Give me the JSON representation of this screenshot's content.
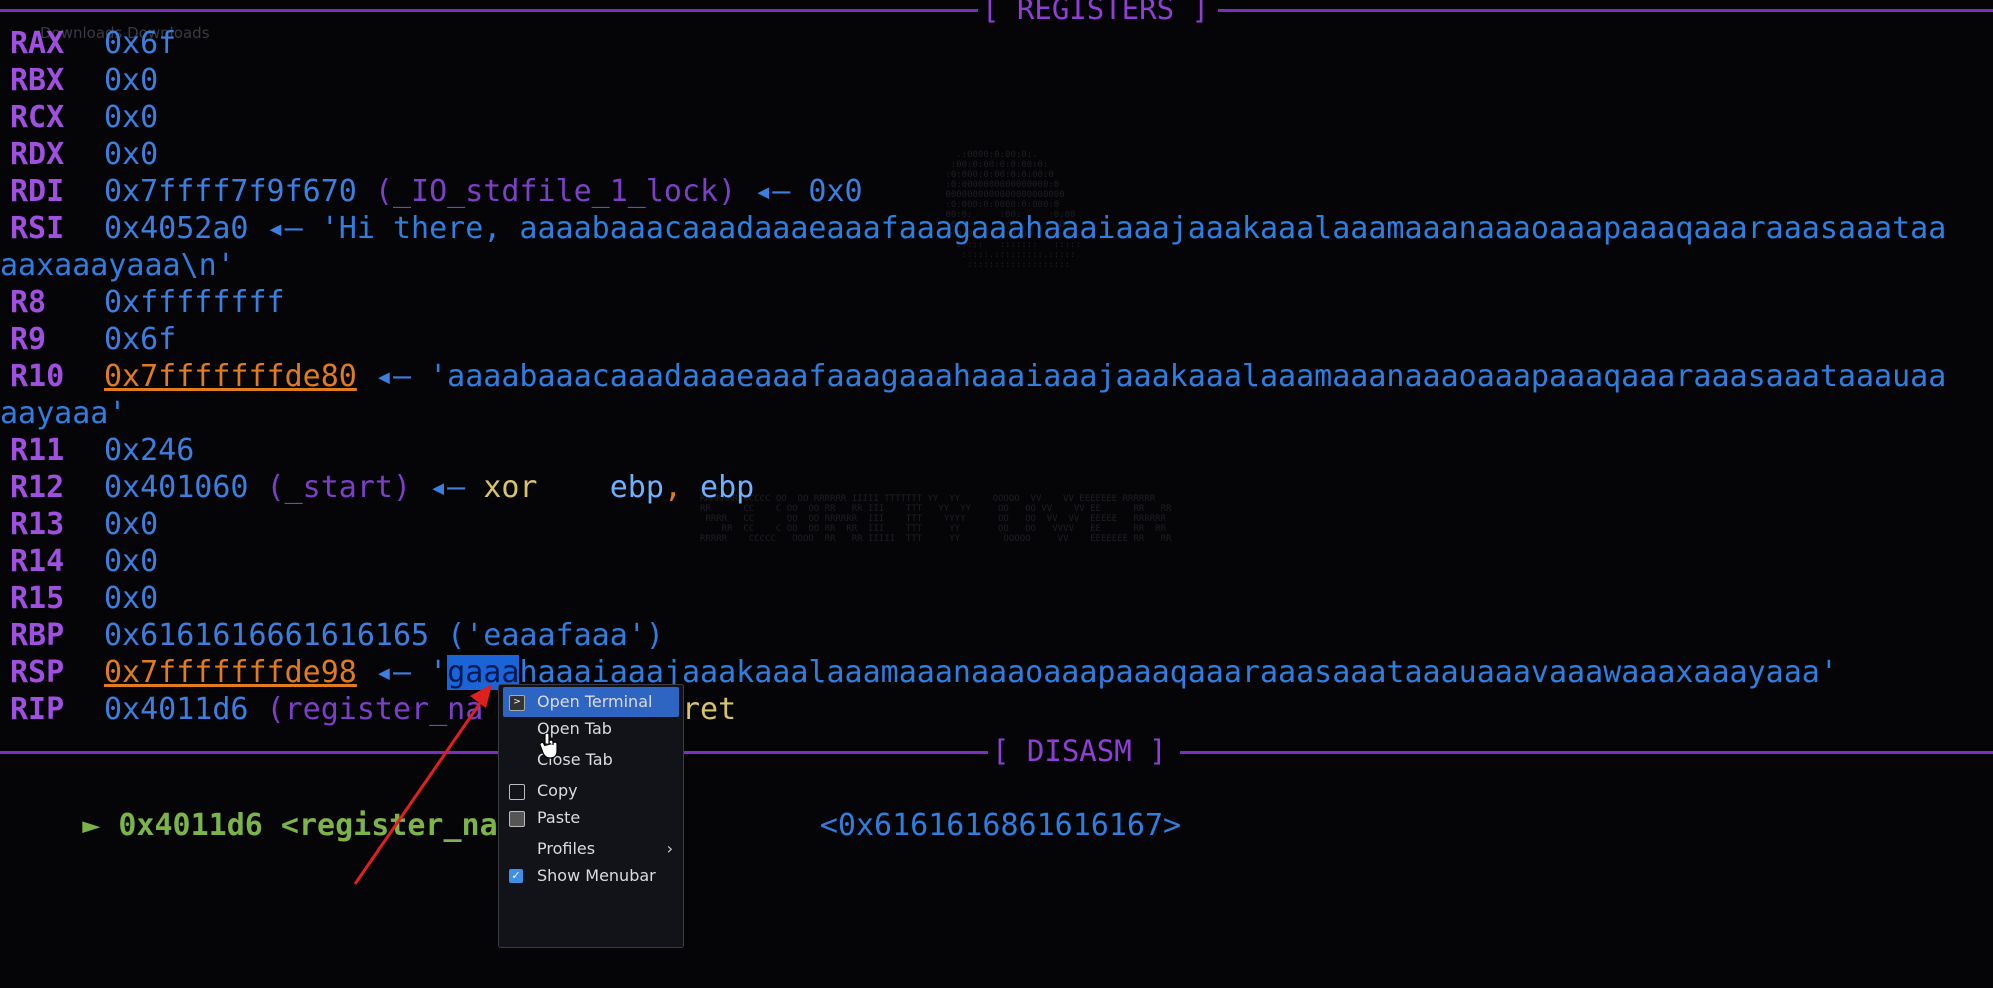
{
  "window": {
    "tab_hint": "Downloads  Downloads"
  },
  "sections": {
    "registers_title": "[ REGISTERS ]",
    "disasm_title": "[ DISASM ]"
  },
  "registers": [
    {
      "name": "RAX",
      "parts": [
        {
          "t": "0x6f",
          "c": "val"
        }
      ]
    },
    {
      "name": "RBX",
      "parts": [
        {
          "t": "0x0",
          "c": "val"
        }
      ]
    },
    {
      "name": "RCX",
      "parts": [
        {
          "t": "0x0",
          "c": "val"
        }
      ]
    },
    {
      "name": "RDX",
      "parts": [
        {
          "t": "0x0",
          "c": "val"
        }
      ]
    },
    {
      "name": "RDI",
      "parts": [
        {
          "t": "0x7ffff7f9f670",
          "c": "val"
        },
        {
          "t": " (_IO_stdfile_1_lock)",
          "c": "sym"
        },
        {
          "t": " ◂— ",
          "c": "arrow"
        },
        {
          "t": "0x0",
          "c": "val"
        }
      ]
    },
    {
      "name": "RSI",
      "parts": [
        {
          "t": "0x4052a0",
          "c": "val"
        },
        {
          "t": " ◂— ",
          "c": "arrow"
        },
        {
          "t": "'Hi there, aaaabaaacaaadaaaeaaafaaagaaahaaaiaaajaaakaaalaaamaaanaaaoaaapaaaqaaaraaasaaataa",
          "c": "str"
        }
      ]
    },
    {
      "name": "",
      "parts": [
        {
          "t": "aaxaaayaaa\\n'",
          "c": "str"
        }
      ],
      "indent": -10
    },
    {
      "name": "R8",
      "parts": [
        {
          "t": "0xffffffff",
          "c": "val"
        }
      ]
    },
    {
      "name": "R9",
      "parts": [
        {
          "t": "0x6f",
          "c": "val"
        }
      ]
    },
    {
      "name": "R10",
      "parts": [
        {
          "t": "0x7fffffffde80",
          "c": "valo"
        },
        {
          "t": " ◂— ",
          "c": "arrow"
        },
        {
          "t": "'aaaabaaacaaadaaaeaaafaaagaaahaaaiaaajaaakaaalaaamaaanaaaoaaapaaaqaaaraaasaaataaauaa",
          "c": "str"
        }
      ]
    },
    {
      "name": "",
      "parts": [
        {
          "t": "aayaaa'",
          "c": "str"
        }
      ],
      "indent": -10
    },
    {
      "name": "R11",
      "parts": [
        {
          "t": "0x246",
          "c": "val"
        }
      ]
    },
    {
      "name": "R12",
      "parts": [
        {
          "t": "0x401060",
          "c": "val"
        },
        {
          "t": " (_start)",
          "c": "sym"
        },
        {
          "t": " ◂— ",
          "c": "arrow"
        },
        {
          "t": "xor",
          "c": "op"
        },
        {
          "t": "    ebp",
          "c": "regname"
        },
        {
          "t": ",",
          "c": "comma"
        },
        {
          "t": " ebp",
          "c": "regname"
        }
      ]
    },
    {
      "name": "R13",
      "parts": [
        {
          "t": "0x0",
          "c": "val"
        }
      ]
    },
    {
      "name": "R14",
      "parts": [
        {
          "t": "0x0",
          "c": "val"
        }
      ]
    },
    {
      "name": "R15",
      "parts": [
        {
          "t": "0x0",
          "c": "val"
        }
      ]
    },
    {
      "name": "RBP",
      "parts": [
        {
          "t": "0x6161616661616165",
          "c": "val"
        },
        {
          "t": " ('eaaafaaa')",
          "c": "str"
        }
      ]
    },
    {
      "name": "RSP",
      "parts": [
        {
          "t": "0x7fffffffde98",
          "c": "valo"
        },
        {
          "t": " ◂— '",
          "c": "arrow"
        },
        {
          "t": "gaaa",
          "c": "hl"
        },
        {
          "t": "haaaiaaajaaakaaalaaamaaanaaaoaaapaaaqaaaraaasaaataaauaaavaaawaaaxaaayaaa'",
          "c": "str"
        }
      ]
    },
    {
      "name": "RIP",
      "parts": [
        {
          "t": "0x4011d6",
          "c": "val"
        },
        {
          "t": " (register_na",
          "c": "sym"
        },
        {
          "t": "           ret",
          "c": "op"
        }
      ]
    }
  ],
  "disasm": {
    "marker": "► 0x4011d6 <register_name+",
    "target": "<0x6161616861616167>"
  },
  "context_menu": {
    "items": [
      {
        "label": "Open Terminal",
        "icon": "terminal-icon",
        "hover": true
      },
      {
        "label": "Open Tab",
        "icon": "",
        "hover": false
      },
      {
        "label": "Close Tab",
        "icon": "",
        "hover": false
      },
      {
        "label": "Copy",
        "icon": "copy-icon",
        "hover": false
      },
      {
        "label": "Paste",
        "icon": "paste-icon",
        "hover": false
      },
      {
        "label": "Profiles",
        "icon": "",
        "hover": false,
        "submenu": true
      },
      {
        "label": "Show Menubar",
        "icon": "checkbox-icon",
        "hover": false,
        "checked": true
      }
    ]
  },
  "colors": {
    "accent_purple": "#7b2fbe",
    "value_blue": "#3d7fe0",
    "pointer_orange": "#e07b1f",
    "highlight": "#1a64d8",
    "annotation_arrow": "#e02020"
  }
}
